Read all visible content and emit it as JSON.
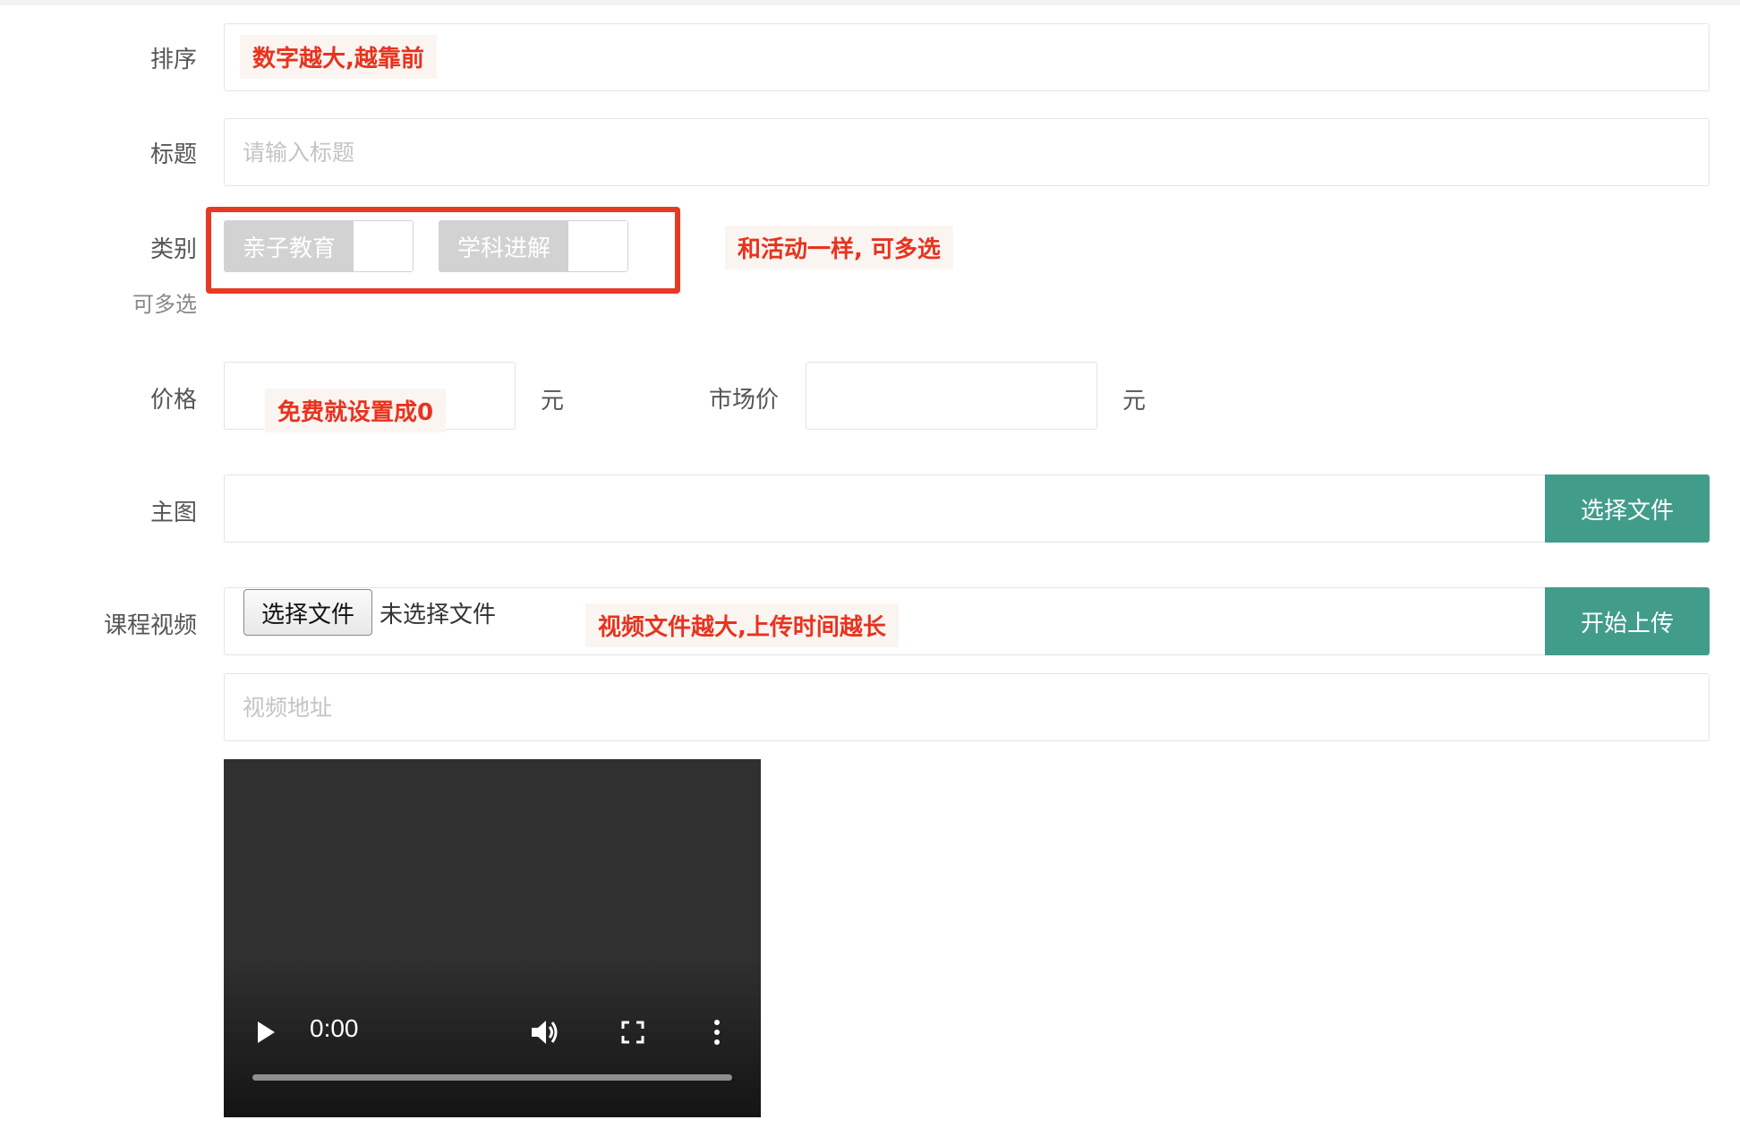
{
  "form": {
    "sort": {
      "label": "排序",
      "note": "数字越大,越靠前"
    },
    "title": {
      "label": "标题",
      "placeholder": "请输入标题"
    },
    "category": {
      "label": "类别",
      "sublabel": "可多选",
      "options": [
        "亲子教育",
        "学科进解"
      ],
      "note": "和活动一样, 可多选"
    },
    "price": {
      "label": "价格",
      "note": "免费就设置成0",
      "unit": "元",
      "market_label": "市场价",
      "market_unit": "元"
    },
    "main_image": {
      "label": "主图",
      "button": "选择文件"
    },
    "course_video": {
      "label": "课程视频",
      "file_button": "选择文件",
      "file_status": "未选择文件",
      "note": "视频文件越大,上传时间越长",
      "upload_button": "开始上传",
      "address_placeholder": "视频地址"
    },
    "player": {
      "time": "0:00"
    }
  },
  "colors": {
    "accent_green": "#429c8a",
    "annotation_red": "#e8331e",
    "checkbox_grey": "#d2d2d2"
  },
  "icons": [
    "play-icon",
    "volume-icon",
    "fullscreen-icon",
    "more-vertical-icon"
  ]
}
